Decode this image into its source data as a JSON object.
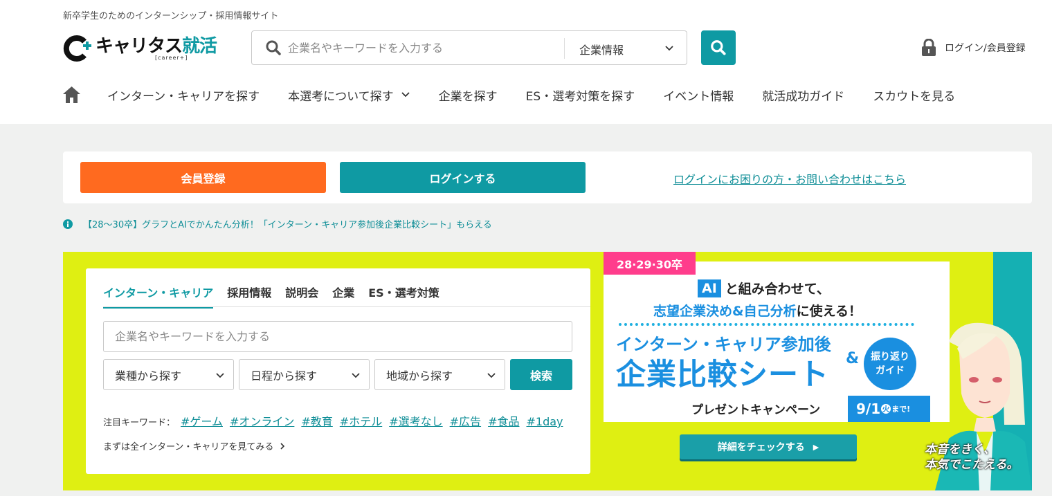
{
  "header": {
    "tagline": "新卒学生のためのインターンシップ・採用情報サイト",
    "logo": {
      "main": "キャリタス",
      "accent": "就活",
      "sub": "[career+]"
    },
    "search": {
      "placeholder": "企業名やキーワードを入力する",
      "category": "企業情報"
    },
    "login": "ログイン/会員登録"
  },
  "nav": {
    "items": [
      {
        "label": "インターン・キャリアを探す"
      },
      {
        "label": "本選考について探す"
      },
      {
        "label": "企業を探す"
      },
      {
        "label": "ES・選考対策を探す"
      },
      {
        "label": "イベント情報"
      },
      {
        "label": "就活成功ガイド"
      },
      {
        "label": "スカウトを見る"
      }
    ]
  },
  "auth": {
    "register": "会員登録",
    "login": "ログインする",
    "help": "ログインにお困りの方・お問い合わせはこちら"
  },
  "notice": "【28〜30卒】グラフとAIでかんたん分析！「インターン・キャリア参加後企業比較シート」もらえる",
  "search_panel": {
    "tabs": [
      "インターン・キャリア",
      "採用情報",
      "説明会",
      "企業",
      "ES・選考対策"
    ],
    "active_tab": 0,
    "placeholder": "企業名やキーワードを入力する",
    "dropdowns": [
      "業種から探す",
      "日程から探す",
      "地域から探す"
    ],
    "search_button": "検索",
    "keywords_label": "注目キーワード：",
    "keywords": [
      "#ゲーム",
      "#オンライン",
      "#教育",
      "#ホテル",
      "#選考なし",
      "#広告",
      "#食品",
      "#1day"
    ],
    "see_all": "まずは全インターン・キャリアを見てみる"
  },
  "banner": {
    "badge": "28·29·30卒",
    "ai": "AI",
    "line1": "と組み合わせて、",
    "line2_blue": "志望企業決め&自己分析",
    "line2_dark": "に使える！",
    "line3": "インターン・キャリア参加後",
    "line4": "企業比較シート",
    "amp": "&",
    "circle_top": "振り返り",
    "circle_bottom": "ガイド",
    "campaign": "プレゼントキャンペーン",
    "date": "9/1",
    "weekday": "火",
    "until": "まで!",
    "detail_button": "詳細をチェックする",
    "slogan_line1": "本音をきく、",
    "slogan_line2": "本気でこたえる。"
  },
  "colors": {
    "teal": "#0f9aa3",
    "orange": "#ff6a1f",
    "lime": "#dfef12",
    "pink": "#ff3d8c",
    "blue": "#1a8fe0"
  }
}
